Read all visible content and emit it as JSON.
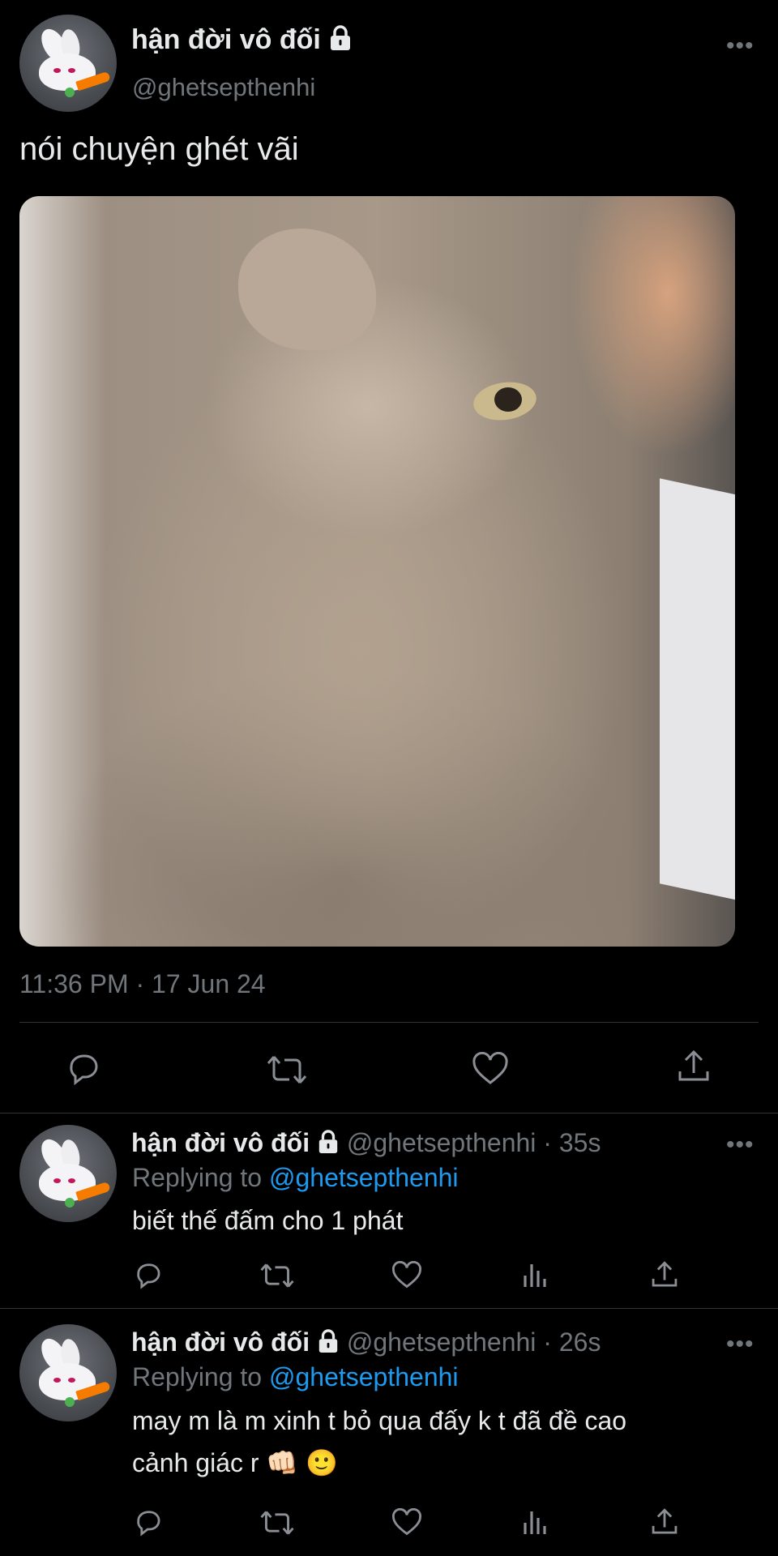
{
  "main_tweet": {
    "display_name": "hận đời vô đối",
    "handle": "@ghetsepthenhi",
    "text": "nói chuyện ghét vãi",
    "timestamp": "11:36 PM · 17 Jun 24",
    "more_label": "•••",
    "media": {
      "type": "image",
      "subject": "grumpy fluffy cat"
    }
  },
  "replies": [
    {
      "display_name": "hận đời vô đối",
      "handle": "@ghetsepthenhi",
      "time": "· 35s",
      "replying_prefix": "Replying to",
      "replying_handle": "@ghetsepthenhi",
      "text": "biết thế đấm cho 1 phát",
      "more_label": "•••"
    },
    {
      "display_name": "hận đời vô đối",
      "handle": "@ghetsepthenhi",
      "time": "· 26s",
      "replying_prefix": "Replying to",
      "replying_handle": "@ghetsepthenhi",
      "text_line1": "may m là m xinh t bỏ qua đấy k t đã đề cao",
      "text_line2": "cảnh giác r 👊🏻 🙂",
      "more_label": "•••"
    }
  ],
  "icons": {
    "reply": "speech-bubble",
    "retweet": "retweet-arrows",
    "like": "heart",
    "views": "bar-chart",
    "share": "upload-arrow",
    "lock": "padlock"
  },
  "colors": {
    "background": "#000000",
    "text": "#e7e9ea",
    "muted": "#71767b",
    "link": "#1d9bf0",
    "divider": "#2f3336"
  }
}
